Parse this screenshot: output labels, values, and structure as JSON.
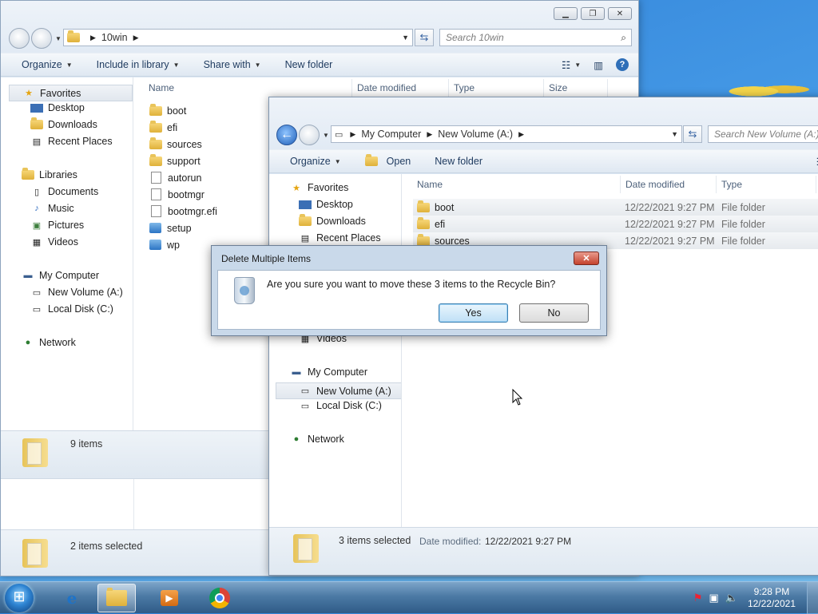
{
  "back_window": {
    "address": {
      "segments": [
        "10win"
      ]
    },
    "search_placeholder": "Search 10win",
    "toolbar": {
      "organize": "Organize",
      "include": "Include in library",
      "share": "Share with",
      "new_folder": "New folder"
    },
    "columns": {
      "name": "Name",
      "date": "Date modified",
      "type": "Type",
      "size": "Size"
    },
    "nav": {
      "favorites": "Favorites",
      "desktop": "Desktop",
      "downloads": "Downloads",
      "recent": "Recent Places",
      "libraries": "Libraries",
      "documents": "Documents",
      "music": "Music",
      "pictures": "Pictures",
      "videos": "Videos",
      "computer": "My Computer",
      "newvol": "New Volume (A:)",
      "localc": "Local Disk (C:)",
      "network": "Network"
    },
    "files": [
      {
        "name": "boot",
        "icon": "folder"
      },
      {
        "name": "efi",
        "icon": "folder"
      },
      {
        "name": "sources",
        "icon": "folder"
      },
      {
        "name": "support",
        "icon": "folder"
      },
      {
        "name": "autorun",
        "icon": "file"
      },
      {
        "name": "bootmgr",
        "icon": "file"
      },
      {
        "name": "bootmgr.efi",
        "icon": "file"
      },
      {
        "name": "setup",
        "icon": "setup"
      },
      {
        "name": "wp",
        "icon": "setup"
      }
    ],
    "status_count": "9 items",
    "status_selected": "2 items selected"
  },
  "front_window": {
    "address": {
      "segments": [
        "My Computer",
        "New Volume (A:)"
      ]
    },
    "search_placeholder": "Search New Volume (A:)",
    "toolbar": {
      "organize": "Organize",
      "open": "Open",
      "new_folder": "New folder"
    },
    "columns": {
      "name": "Name",
      "date": "Date modified",
      "type": "Type"
    },
    "nav": {
      "favorites": "Favorites",
      "desktop": "Desktop",
      "downloads": "Downloads",
      "recent": "Recent Places",
      "videos": "Videos",
      "computer": "My Computer",
      "newvol": "New Volume (A:)",
      "localc": "Local Disk (C:)",
      "network": "Network"
    },
    "files": [
      {
        "name": "boot",
        "date": "12/22/2021 9:27 PM",
        "type": "File folder"
      },
      {
        "name": "efi",
        "date": "12/22/2021 9:27 PM",
        "type": "File folder"
      },
      {
        "name": "sources",
        "date": "12/22/2021 9:27 PM",
        "type": "File folder"
      }
    ],
    "status_selected": "3 items selected",
    "status_date_label": "Date modified:",
    "status_date_value": "12/22/2021 9:27 PM"
  },
  "dialog": {
    "title": "Delete Multiple Items",
    "message": "Are you sure you want to move these 3 items to the Recycle Bin?",
    "yes": "Yes",
    "no": "No"
  },
  "taskbar": {
    "time": "9:28 PM",
    "date": "12/22/2021",
    "apps": [
      "internet-explorer-icon",
      "explorer-icon",
      "media-player-icon",
      "chrome-icon"
    ]
  }
}
